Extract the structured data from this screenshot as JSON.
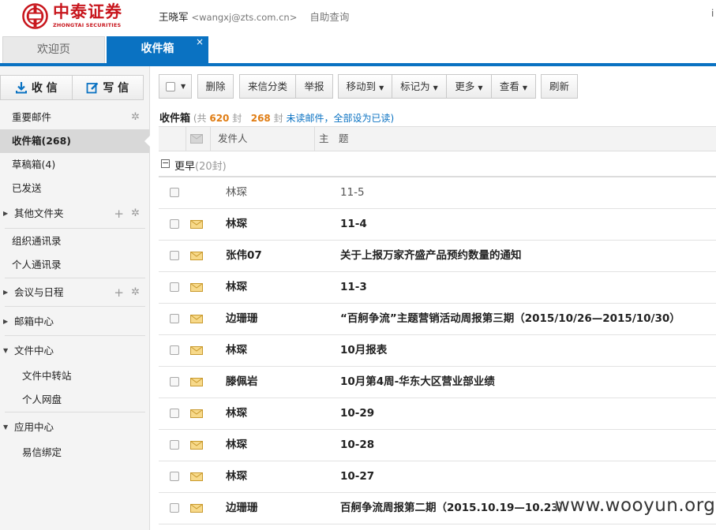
{
  "header": {
    "logo_cn": "中泰证券",
    "logo_en": "ZHONGTAI SECURITIES",
    "user_name": "王晓军",
    "user_email": "<wangxj@zts.com.cn>",
    "self_query": "自助查询",
    "brand_color": "#c8161d"
  },
  "tabs": [
    {
      "label": "欢迎页",
      "active": false
    },
    {
      "label": "收件箱",
      "active": true,
      "close": "×"
    }
  ],
  "sidebar": {
    "receive_label": "收 信",
    "compose_label": "写 信",
    "items": [
      {
        "label": "重要邮件"
      },
      {
        "label": "收件箱(268)"
      },
      {
        "label": "草稿箱(4)"
      },
      {
        "label": "已发送"
      },
      {
        "label": "其他文件夹"
      },
      {
        "label": "组织通讯录"
      },
      {
        "label": "个人通讯录"
      },
      {
        "label": "会议与日程"
      },
      {
        "label": "邮箱中心"
      },
      {
        "label": "文件中心"
      },
      {
        "label": "文件中转站"
      },
      {
        "label": "个人网盘"
      },
      {
        "label": "应用中心"
      },
      {
        "label": "易信绑定"
      }
    ]
  },
  "toolbar": {
    "delete": "删除",
    "classify": "来信分类",
    "report": "举报",
    "move_to": "移动到",
    "mark_as": "标记为",
    "more": "更多",
    "view": "查看",
    "refresh": "刷新"
  },
  "summary": {
    "title": "收件箱",
    "total_prefix": "(共",
    "total": "620",
    "total_suffix": "封",
    "unread": "268",
    "unread_unit": "封",
    "unread_link": "未读邮件",
    "mark_all": "，全部设为已读)"
  },
  "columns": {
    "sender": "发件人",
    "subject": "主　题"
  },
  "group": {
    "toggle": "−",
    "label": "更早",
    "count": "(20封)"
  },
  "mails": [
    {
      "sender": "林琛",
      "subject": "11-5",
      "unread": false
    },
    {
      "sender": "林琛",
      "subject": "11-4",
      "unread": true
    },
    {
      "sender": "张伟07",
      "subject": "关于上报万家齐盛产品预约数量的通知",
      "unread": true
    },
    {
      "sender": "林琛",
      "subject": "11-3",
      "unread": true
    },
    {
      "sender": "边珊珊",
      "subject": "“百舸争流”主题营销活动周报第三期（2015/10/26—2015/10/30）",
      "unread": true
    },
    {
      "sender": "林琛",
      "subject": "10月报表",
      "unread": true
    },
    {
      "sender": "滕佩岩",
      "subject": "10月第4周-华东大区营业部业绩",
      "unread": true
    },
    {
      "sender": "林琛",
      "subject": "10-29",
      "unread": true
    },
    {
      "sender": "林琛",
      "subject": "10-28",
      "unread": true
    },
    {
      "sender": "林琛",
      "subject": "10-27",
      "unread": true
    },
    {
      "sender": "边珊珊",
      "subject": "百舸争流周报第二期（2015.10.19—10.23）",
      "unread": true
    }
  ],
  "watermark": "www.wooyun.org",
  "accent_color": "#0a72c2",
  "unread_count_color": "#e07d14"
}
